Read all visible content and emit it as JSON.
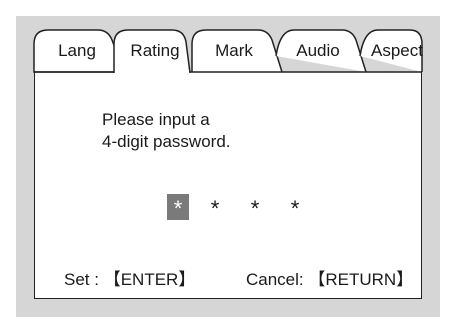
{
  "tabs": [
    {
      "label": "Lang"
    },
    {
      "label": "Rating"
    },
    {
      "label": "Mark"
    },
    {
      "label": "Audio"
    },
    {
      "label": "Aspect"
    }
  ],
  "active_tab": "Rating",
  "dialog": {
    "instruction_line1": "Please input a",
    "instruction_line2": "4-digit password.",
    "password_digits": [
      "*",
      "*",
      "*",
      "*"
    ],
    "selected_digit": 1
  },
  "footer": {
    "set_label": "Set :",
    "set_key": "【ENTER】",
    "cancel_label": "Cancel:",
    "cancel_key": "【RETURN】"
  },
  "colors": {
    "frame": "#d6d6d6",
    "panel": "#ffffff",
    "selection": "#7a7a7a"
  }
}
